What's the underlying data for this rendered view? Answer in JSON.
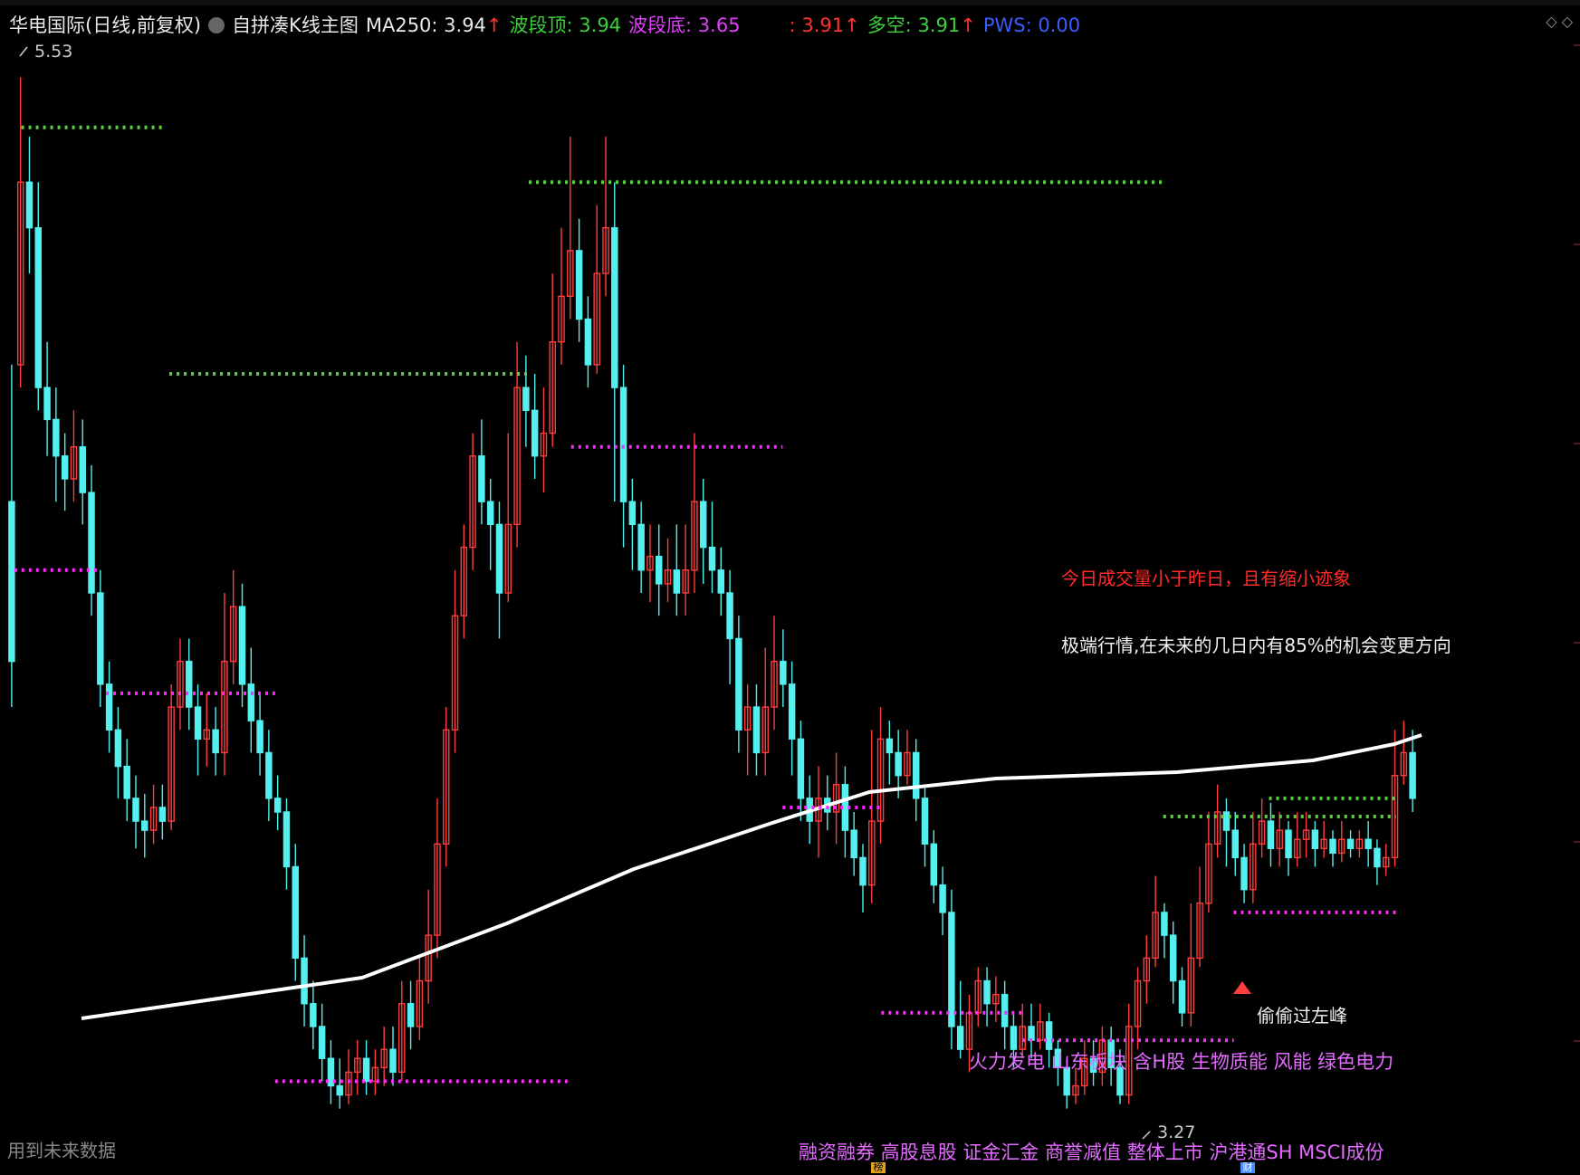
{
  "header": {
    "stock": "华电国际(日线,前复权)",
    "indicator": "自拼凑K线主图",
    "ma_label": "MA250: 3.94",
    "ma_arrow": "↑",
    "top_label": "波段顶: 3.94",
    "bottom_label": "波段底: 3.65",
    "blank_label": ": 3.91",
    "blank_arrow": "↑",
    "bullbear_label": "多空: 3.91",
    "bullbear_arrow": "↑",
    "pws_label": "PWS: 0.00"
  },
  "right_icons": "◇ ◇",
  "labels": {
    "high": "5.53",
    "low": "3.27",
    "future_data": "用到未来数据",
    "volume_note": "今日成交量小于昨日，且有缩小迹象",
    "extreme_note": "极端行情,在未来的几日内有85%的机会变更方向",
    "peak_note": "偷偷过左峰",
    "concepts1": "火力发电 山东板块 含H股 生物质能 风能 绿色电力",
    "concepts2": "融资融券 高股息股 证金汇金 商誉减值 整体上市 沪港通SH MSCI成份",
    "badge1": "榜",
    "badge2": "财"
  },
  "colors": {
    "background": "#000000",
    "up": "#ff3d3d",
    "down": "#54f0f0",
    "ma": "#ffffff",
    "top_dots": "#5bd33a",
    "bottom_dots": "#ff2bff",
    "header_green": "#3bd13b",
    "header_magenta": "#e040fb",
    "header_red": "#ff3030",
    "header_blue": "#3c5bff",
    "note_red": "#ff2a2a",
    "note_white": "#f0f0f0",
    "concept": "#e36bff"
  },
  "chart_data": {
    "type": "candlestick",
    "ylim": [
      3.2,
      5.6
    ],
    "candles": [
      [
        4.6,
        4.25,
        4.9,
        4.15
      ],
      [
        4.9,
        5.3,
        5.53,
        4.85
      ],
      [
        5.3,
        5.2,
        5.4,
        5.1
      ],
      [
        5.2,
        4.85,
        5.3,
        4.8
      ],
      [
        4.85,
        4.78,
        4.95,
        4.7
      ],
      [
        4.78,
        4.7,
        4.85,
        4.6
      ],
      [
        4.7,
        4.65,
        4.75,
        4.58
      ],
      [
        4.65,
        4.72,
        4.8,
        4.6
      ],
      [
        4.72,
        4.62,
        4.78,
        4.55
      ],
      [
        4.62,
        4.4,
        4.68,
        4.35
      ],
      [
        4.4,
        4.2,
        4.45,
        4.15
      ],
      [
        4.2,
        4.1,
        4.25,
        4.05
      ],
      [
        4.1,
        4.02,
        4.15,
        3.95
      ],
      [
        4.02,
        3.95,
        4.08,
        3.9
      ],
      [
        3.95,
        3.9,
        4.0,
        3.84
      ],
      [
        3.9,
        3.88,
        3.96,
        3.82
      ],
      [
        3.88,
        3.93,
        3.98,
        3.85
      ],
      [
        3.93,
        3.9,
        3.98,
        3.86
      ],
      [
        3.9,
        4.15,
        4.2,
        3.88
      ],
      [
        4.15,
        4.25,
        4.3,
        4.1
      ],
      [
        4.25,
        4.15,
        4.3,
        4.1
      ],
      [
        4.15,
        4.08,
        4.2,
        4.0
      ],
      [
        4.08,
        4.1,
        4.18,
        4.02
      ],
      [
        4.1,
        4.05,
        4.15,
        4.0
      ],
      [
        4.05,
        4.25,
        4.4,
        4.0
      ],
      [
        4.25,
        4.37,
        4.45,
        4.2
      ],
      [
        4.37,
        4.2,
        4.42,
        4.15
      ],
      [
        4.2,
        4.12,
        4.28,
        4.05
      ],
      [
        4.12,
        4.05,
        4.18,
        4.0
      ],
      [
        4.05,
        3.95,
        4.1,
        3.9
      ],
      [
        3.95,
        3.92,
        4.0,
        3.88
      ],
      [
        3.92,
        3.8,
        3.95,
        3.75
      ],
      [
        3.8,
        3.6,
        3.85,
        3.55
      ],
      [
        3.6,
        3.5,
        3.65,
        3.45
      ],
      [
        3.5,
        3.45,
        3.55,
        3.4
      ],
      [
        3.45,
        3.38,
        3.5,
        3.33
      ],
      [
        3.38,
        3.32,
        3.42,
        3.28
      ],
      [
        3.32,
        3.3,
        3.38,
        3.27
      ],
      [
        3.3,
        3.35,
        3.4,
        3.28
      ],
      [
        3.35,
        3.38,
        3.42,
        3.3
      ],
      [
        3.38,
        3.33,
        3.42,
        3.3
      ],
      [
        3.33,
        3.36,
        3.4,
        3.3
      ],
      [
        3.36,
        3.4,
        3.45,
        3.32
      ],
      [
        3.4,
        3.35,
        3.45,
        3.32
      ],
      [
        3.35,
        3.5,
        3.55,
        3.33
      ],
      [
        3.5,
        3.45,
        3.55,
        3.4
      ],
      [
        3.45,
        3.55,
        3.6,
        3.42
      ],
      [
        3.55,
        3.65,
        3.75,
        3.5
      ],
      [
        3.65,
        3.85,
        3.95,
        3.6
      ],
      [
        3.85,
        4.1,
        4.15,
        3.8
      ],
      [
        4.1,
        4.35,
        4.45,
        4.05
      ],
      [
        4.35,
        4.5,
        4.55,
        4.3
      ],
      [
        4.5,
        4.7,
        4.75,
        4.45
      ],
      [
        4.7,
        4.6,
        4.78,
        4.55
      ],
      [
        4.6,
        4.55,
        4.65,
        4.45
      ],
      [
        4.55,
        4.4,
        4.6,
        4.3
      ],
      [
        4.4,
        4.55,
        4.75,
        4.38
      ],
      [
        4.55,
        4.85,
        4.95,
        4.5
      ],
      [
        4.85,
        4.8,
        4.92,
        4.72
      ],
      [
        4.8,
        4.7,
        4.88,
        4.65
      ],
      [
        4.7,
        4.75,
        4.85,
        4.62
      ],
      [
        4.75,
        4.95,
        5.1,
        4.72
      ],
      [
        4.95,
        5.05,
        5.2,
        4.9
      ],
      [
        5.05,
        5.15,
        5.4,
        5.0
      ],
      [
        5.15,
        5.0,
        5.22,
        4.95
      ],
      [
        5.0,
        4.9,
        5.05,
        4.85
      ],
      [
        4.9,
        5.1,
        5.25,
        4.88
      ],
      [
        5.1,
        5.2,
        5.4,
        5.05
      ],
      [
        5.2,
        4.85,
        5.3,
        4.6
      ],
      [
        4.85,
        4.6,
        4.9,
        4.5
      ],
      [
        4.6,
        4.55,
        4.65,
        4.45
      ],
      [
        4.55,
        4.45,
        4.6,
        4.4
      ],
      [
        4.45,
        4.48,
        4.55,
        4.38
      ],
      [
        4.48,
        4.42,
        4.55,
        4.35
      ],
      [
        4.42,
        4.45,
        4.52,
        4.38
      ],
      [
        4.45,
        4.4,
        4.55,
        4.35
      ],
      [
        4.4,
        4.45,
        4.55,
        4.35
      ],
      [
        4.45,
        4.6,
        4.75,
        4.4
      ],
      [
        4.6,
        4.5,
        4.65,
        4.42
      ],
      [
        4.5,
        4.45,
        4.6,
        4.4
      ],
      [
        4.45,
        4.4,
        4.5,
        4.35
      ],
      [
        4.4,
        4.3,
        4.45,
        4.2
      ],
      [
        4.3,
        4.1,
        4.35,
        4.05
      ],
      [
        4.1,
        4.15,
        4.2,
        4.0
      ],
      [
        4.15,
        4.05,
        4.2,
        4.0
      ],
      [
        4.05,
        4.15,
        4.28,
        4.0
      ],
      [
        4.15,
        4.25,
        4.35,
        4.1
      ],
      [
        4.25,
        4.2,
        4.32,
        4.15
      ],
      [
        4.2,
        4.08,
        4.25,
        4.0
      ],
      [
        4.08,
        3.95,
        4.12,
        3.9
      ],
      [
        3.95,
        3.9,
        4.0,
        3.85
      ],
      [
        3.9,
        3.95,
        4.02,
        3.82
      ],
      [
        3.95,
        3.92,
        4.0,
        3.88
      ],
      [
        3.92,
        3.98,
        4.05,
        3.85
      ],
      [
        3.98,
        3.88,
        4.02,
        3.82
      ],
      [
        3.88,
        3.82,
        3.92,
        3.78
      ],
      [
        3.82,
        3.76,
        3.85,
        3.7
      ],
      [
        3.76,
        3.9,
        4.1,
        3.72
      ],
      [
        3.9,
        4.08,
        4.15,
        3.85
      ],
      [
        4.08,
        4.05,
        4.12,
        3.98
      ],
      [
        4.05,
        4.0,
        4.1,
        3.95
      ],
      [
        4.0,
        4.05,
        4.1,
        3.98
      ],
      [
        4.05,
        3.95,
        4.08,
        3.9
      ],
      [
        3.95,
        3.85,
        3.98,
        3.8
      ],
      [
        3.85,
        3.76,
        3.88,
        3.72
      ],
      [
        3.76,
        3.7,
        3.8,
        3.65
      ],
      [
        3.7,
        3.45,
        3.75,
        3.4
      ],
      [
        3.45,
        3.4,
        3.55,
        3.38
      ],
      [
        3.4,
        3.48,
        3.52,
        3.35
      ],
      [
        3.48,
        3.55,
        3.58,
        3.45
      ],
      [
        3.55,
        3.5,
        3.58,
        3.45
      ],
      [
        3.5,
        3.52,
        3.56,
        3.46
      ],
      [
        3.52,
        3.45,
        3.55,
        3.4
      ],
      [
        3.45,
        3.4,
        3.48,
        3.36
      ],
      [
        3.4,
        3.45,
        3.5,
        3.38
      ],
      [
        3.45,
        3.42,
        3.5,
        3.38
      ],
      [
        3.42,
        3.46,
        3.5,
        3.4
      ],
      [
        3.46,
        3.4,
        3.48,
        3.36
      ],
      [
        3.4,
        3.36,
        3.42,
        3.32
      ],
      [
        3.36,
        3.3,
        3.38,
        3.27
      ],
      [
        3.3,
        3.32,
        3.36,
        3.28
      ],
      [
        3.32,
        3.38,
        3.42,
        3.3
      ],
      [
        3.38,
        3.35,
        3.42,
        3.32
      ],
      [
        3.35,
        3.42,
        3.45,
        3.32
      ],
      [
        3.42,
        3.36,
        3.45,
        3.32
      ],
      [
        3.36,
        3.3,
        3.4,
        3.28
      ],
      [
        3.3,
        3.45,
        3.5,
        3.28
      ],
      [
        3.45,
        3.55,
        3.58,
        3.4
      ],
      [
        3.55,
        3.6,
        3.65,
        3.5
      ],
      [
        3.6,
        3.7,
        3.78,
        3.58
      ],
      [
        3.7,
        3.65,
        3.72,
        3.6
      ],
      [
        3.65,
        3.55,
        3.68,
        3.5
      ],
      [
        3.55,
        3.48,
        3.58,
        3.45
      ],
      [
        3.48,
        3.6,
        3.72,
        3.45
      ],
      [
        3.6,
        3.72,
        3.8,
        3.58
      ],
      [
        3.72,
        3.85,
        3.92,
        3.7
      ],
      [
        3.85,
        3.92,
        3.98,
        3.82
      ],
      [
        3.92,
        3.88,
        3.95,
        3.8
      ],
      [
        3.88,
        3.82,
        3.92,
        3.78
      ],
      [
        3.82,
        3.75,
        3.85,
        3.72
      ],
      [
        3.75,
        3.85,
        3.92,
        3.72
      ],
      [
        3.85,
        3.9,
        3.95,
        3.82
      ],
      [
        3.9,
        3.84,
        3.94,
        3.8
      ],
      [
        3.84,
        3.88,
        3.92,
        3.8
      ],
      [
        3.88,
        3.82,
        3.9,
        3.78
      ],
      [
        3.82,
        3.86,
        3.92,
        3.8
      ],
      [
        3.86,
        3.88,
        3.92,
        3.82
      ],
      [
        3.88,
        3.84,
        3.9,
        3.8
      ],
      [
        3.84,
        3.86,
        3.9,
        3.82
      ],
      [
        3.86,
        3.83,
        3.88,
        3.8
      ],
      [
        3.83,
        3.86,
        3.9,
        3.81
      ],
      [
        3.86,
        3.84,
        3.88,
        3.82
      ],
      [
        3.84,
        3.86,
        3.88,
        3.82
      ],
      [
        3.86,
        3.84,
        3.9,
        3.8
      ],
      [
        3.84,
        3.8,
        3.86,
        3.76
      ],
      [
        3.8,
        3.82,
        3.85,
        3.78
      ],
      [
        3.82,
        4.0,
        4.1,
        3.8
      ],
      [
        4.0,
        4.05,
        4.12,
        3.98
      ],
      [
        4.05,
        3.95,
        4.1,
        3.92
      ]
    ],
    "ma250": [
      [
        90,
        1125
      ],
      [
        400,
        1080
      ],
      [
        560,
        1020
      ],
      [
        700,
        960
      ],
      [
        850,
        910
      ],
      [
        960,
        875
      ],
      [
        1100,
        860
      ],
      [
        1300,
        853
      ],
      [
        1450,
        840
      ],
      [
        1540,
        822
      ],
      [
        1570,
        812
      ]
    ],
    "top_lines": [
      [
        0.01,
        0.11,
        5.42
      ],
      [
        0.37,
        0.82,
        5.3
      ],
      [
        0.115,
        0.37,
        4.88
      ],
      [
        0.82,
        0.985,
        3.91
      ],
      [
        0.895,
        0.985,
        3.95
      ]
    ],
    "bottom_lines": [
      [
        0.005,
        0.066,
        4.45
      ],
      [
        0.07,
        0.19,
        4.18
      ],
      [
        0.19,
        0.4,
        3.33
      ],
      [
        0.4,
        0.55,
        4.72
      ],
      [
        0.55,
        0.62,
        3.93
      ],
      [
        0.62,
        0.72,
        3.48
      ],
      [
        0.72,
        0.87,
        3.42
      ],
      [
        0.87,
        0.985,
        3.7
      ]
    ]
  }
}
